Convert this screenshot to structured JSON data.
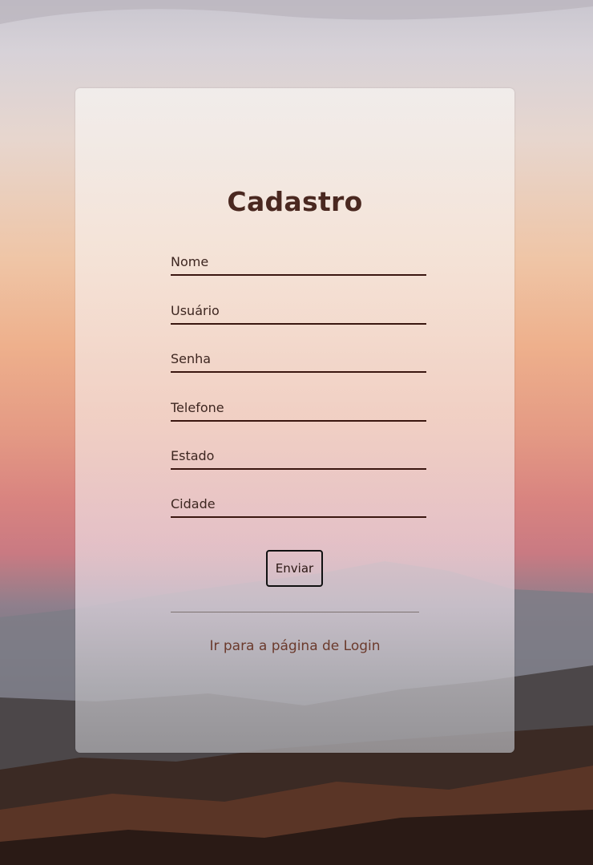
{
  "form": {
    "title": "Cadastro",
    "fields": [
      {
        "placeholder": "Nome",
        "value": ""
      },
      {
        "placeholder": "Usuário",
        "value": ""
      },
      {
        "placeholder": "Senha",
        "value": ""
      },
      {
        "placeholder": "Telefone",
        "value": ""
      },
      {
        "placeholder": "Estado",
        "value": ""
      },
      {
        "placeholder": "Cidade",
        "value": ""
      }
    ],
    "submit_label": "Enviar",
    "login_link": "Ir para a página de Login"
  },
  "colors": {
    "title_text": "#4a2820",
    "field_underline": "#3a1610",
    "link_text": "#6b3a2c"
  }
}
